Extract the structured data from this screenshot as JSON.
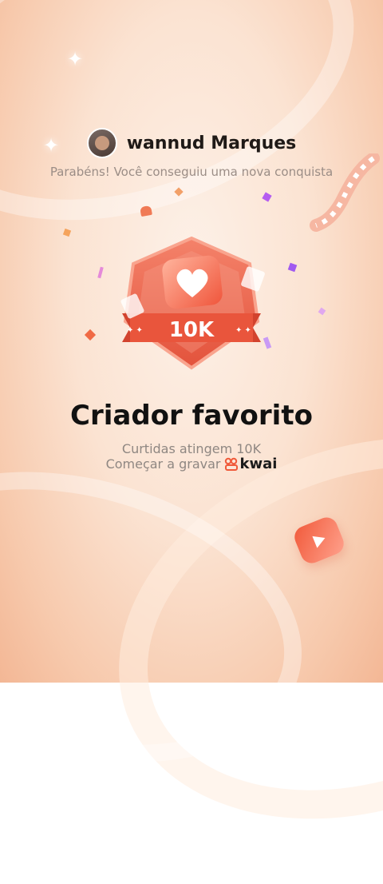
{
  "user": {
    "name": "wannud Marques"
  },
  "congrats_text": "Parabéns! Você conseguiu uma nova conquista",
  "badge": {
    "count_label": "10K"
  },
  "achievement": {
    "title": "Criador favorito",
    "subtitle": "Curtidas atingem 10K",
    "cta_text": "Começar a gravar",
    "brand": "kwai"
  },
  "colors": {
    "accent": "#f05a3a",
    "badge_dark": "#d44a32",
    "text_dark": "#111111",
    "text_muted": "#8f8782"
  },
  "icons": [
    "heart-icon",
    "kwai-logo-icon",
    "play-icon",
    "sparkle-icon"
  ]
}
